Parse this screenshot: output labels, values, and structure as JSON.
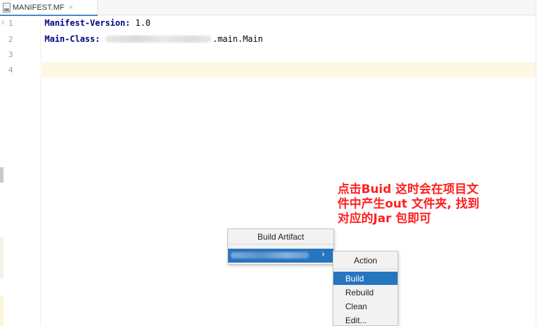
{
  "tab": {
    "label": "MANIFEST.MF",
    "close_glyph": "×"
  },
  "gutter": {
    "line_numbers": [
      "1",
      "2",
      "3",
      "4"
    ],
    "marker": "x"
  },
  "editor": {
    "line1": {
      "key": "Manifest-Version:",
      "value": " 1.0"
    },
    "line2": {
      "key": "Main-Class:",
      "value": ".main.Main"
    }
  },
  "annotation": {
    "lines": [
      "点击Buid 这时会在项目文",
      "件中产生out 文件夹, 找到",
      "对应的Jar 包即可"
    ]
  },
  "menu_build_artifact": {
    "header": "Build Artifact",
    "submenu_arrow": "›"
  },
  "menu_action": {
    "header": "Action",
    "items": [
      "Build",
      "Rebuild",
      "Clean",
      "Edit..."
    ],
    "selected_index": 0
  },
  "colors": {
    "keyword": "#000080",
    "selection": "#2675bf",
    "annotation": "#ff1e1e",
    "current_line": "#fdf8e1"
  },
  "icons": {
    "file": "manifest-file-icon"
  }
}
